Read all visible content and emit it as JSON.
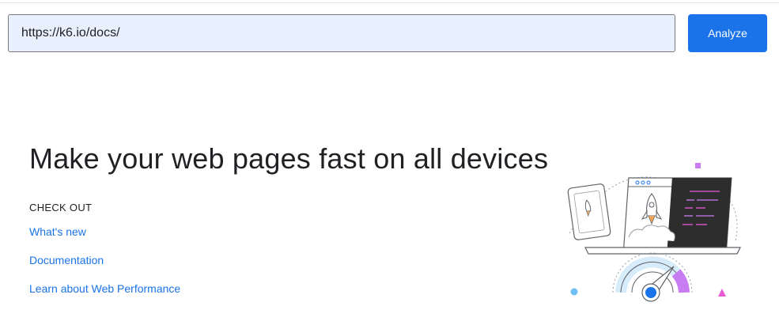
{
  "url_bar": {
    "value": "https://k6.io/docs/",
    "analyze_label": "Analyze"
  },
  "hero": {
    "headline": "Make your web pages fast on all devices",
    "section_label": "CHECK OUT",
    "links": [
      {
        "label": "What's new"
      },
      {
        "label": "Documentation"
      },
      {
        "label": "Learn about Web Performance"
      }
    ]
  },
  "illustration": {
    "icon": "devices-speed-gauge-illustration",
    "colors": {
      "accent_blue": "#1a73e8",
      "accent_purple": "#c87cf2",
      "light_blue": "#d6ecfa",
      "dark_panel": "#2d2d2d",
      "pink": "#e95ad8"
    }
  },
  "colors": {
    "input_background": "#e8f0fe",
    "button_background": "#1a73e8",
    "link": "#1a73e8",
    "text": "#202124"
  }
}
